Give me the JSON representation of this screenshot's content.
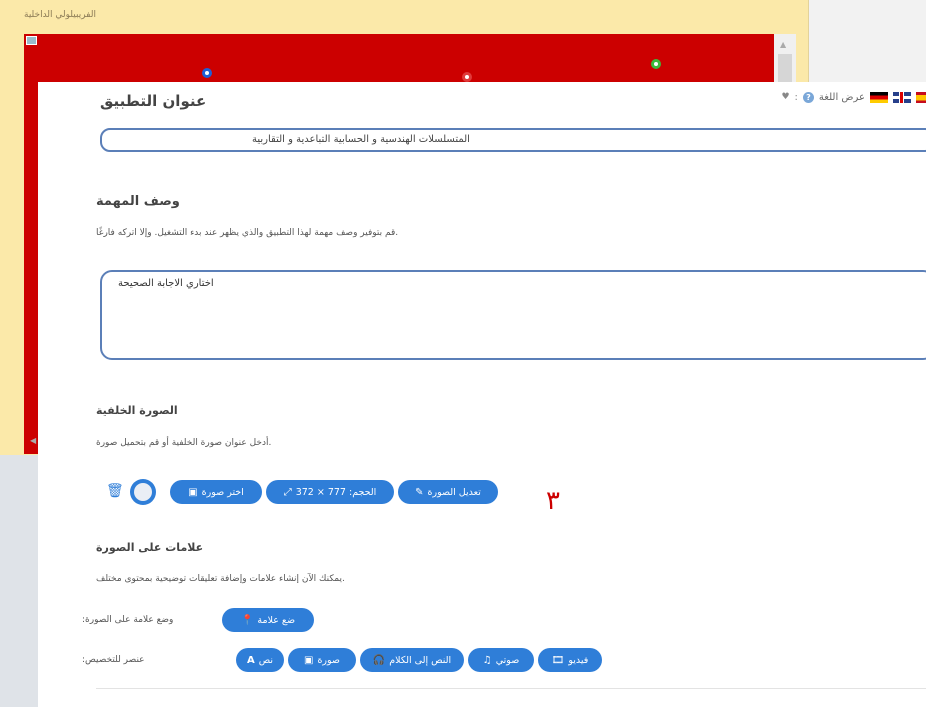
{
  "background_window": {
    "title": "الفريبيلولي الداخلية"
  },
  "header": {
    "app_title_label": "عنوان التطبيق",
    "lang_label": "عرض اللغة",
    "help": "?",
    "colon": ":",
    "heart": "♥"
  },
  "app_title_input": {
    "value": "المتسلسلات الهندسية و الحسابية التباعدية و التقاربية"
  },
  "task": {
    "heading": "وصف المهمة",
    "hint": ".قم بتوفير وصف مهمة لهذا التطبيق والذي يظهر عند بدء التشغيل. وإلا اتركه فارغًا",
    "value": "اختاري الاجابة الصحيحة"
  },
  "background_image": {
    "heading": "الصورة الخلفية",
    "hint": ".أدخل عنوان صورة الخلفية أو قم بتحميل صورة",
    "edit_button": "تعديل الصورة",
    "size_button": "الحجم: 777 × 372",
    "choose_button": "اختر صورة"
  },
  "annotation": {
    "big_number": "٣"
  },
  "markers": {
    "heading": "علامات على الصورة",
    "hint": ".يمكنك الآن إنشاء علامات وإضافة تعليقات توضيحية بمحتوى مختلف",
    "place_label": "وضع علامة على الصورة:",
    "place_button": "ضع علامة",
    "custom_label": "عنصر للتخصيص:",
    "elements": [
      {
        "label": "فيديو",
        "icon": "film-icon"
      },
      {
        "label": "صوتي",
        "icon": "music-icon"
      },
      {
        "label": "النص إلى الكلام",
        "icon": "headphones-icon"
      },
      {
        "label": "صورة",
        "icon": "image-icon"
      },
      {
        "label": "نص",
        "icon": "text-icon"
      }
    ]
  },
  "colors": {
    "accent": "#2f7ed8",
    "input_border": "#5b7fb8",
    "canvas_red": "#cc0000",
    "bg_yellow": "#fbe9a9"
  }
}
